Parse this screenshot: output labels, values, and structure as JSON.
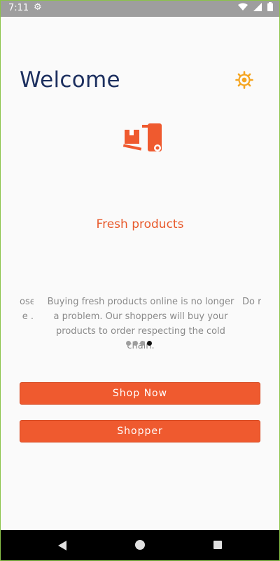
{
  "status_bar": {
    "time": "7:11",
    "icons": [
      "settings-gear-icon",
      "wifi-icon",
      "signal-icon",
      "battery-icon"
    ]
  },
  "header": {
    "title": "Welcome",
    "settings_icon": "sun-gear-icon",
    "settings_color": "#f5a623"
  },
  "slide": {
    "icon": "delivery-truck-icon",
    "title": "Fresh products",
    "text": "Buying fresh products online is no longer a problem. Our shoppers will buy your products to order respecting the cold chain.",
    "prev_peek": "ose e .",
    "next_peek": "Do r purc"
  },
  "carousel": {
    "total_pages": 4,
    "active_page": 4
  },
  "buttons": {
    "shop_now": "Shop Now",
    "shopper": "Shopper"
  },
  "colors": {
    "accent": "#ef5a2f",
    "title": "#1c2f5f",
    "status_bar": "#9e9e9e"
  },
  "nav_bar": {
    "icons": [
      "back-icon",
      "home-icon",
      "recent-apps-icon"
    ]
  }
}
